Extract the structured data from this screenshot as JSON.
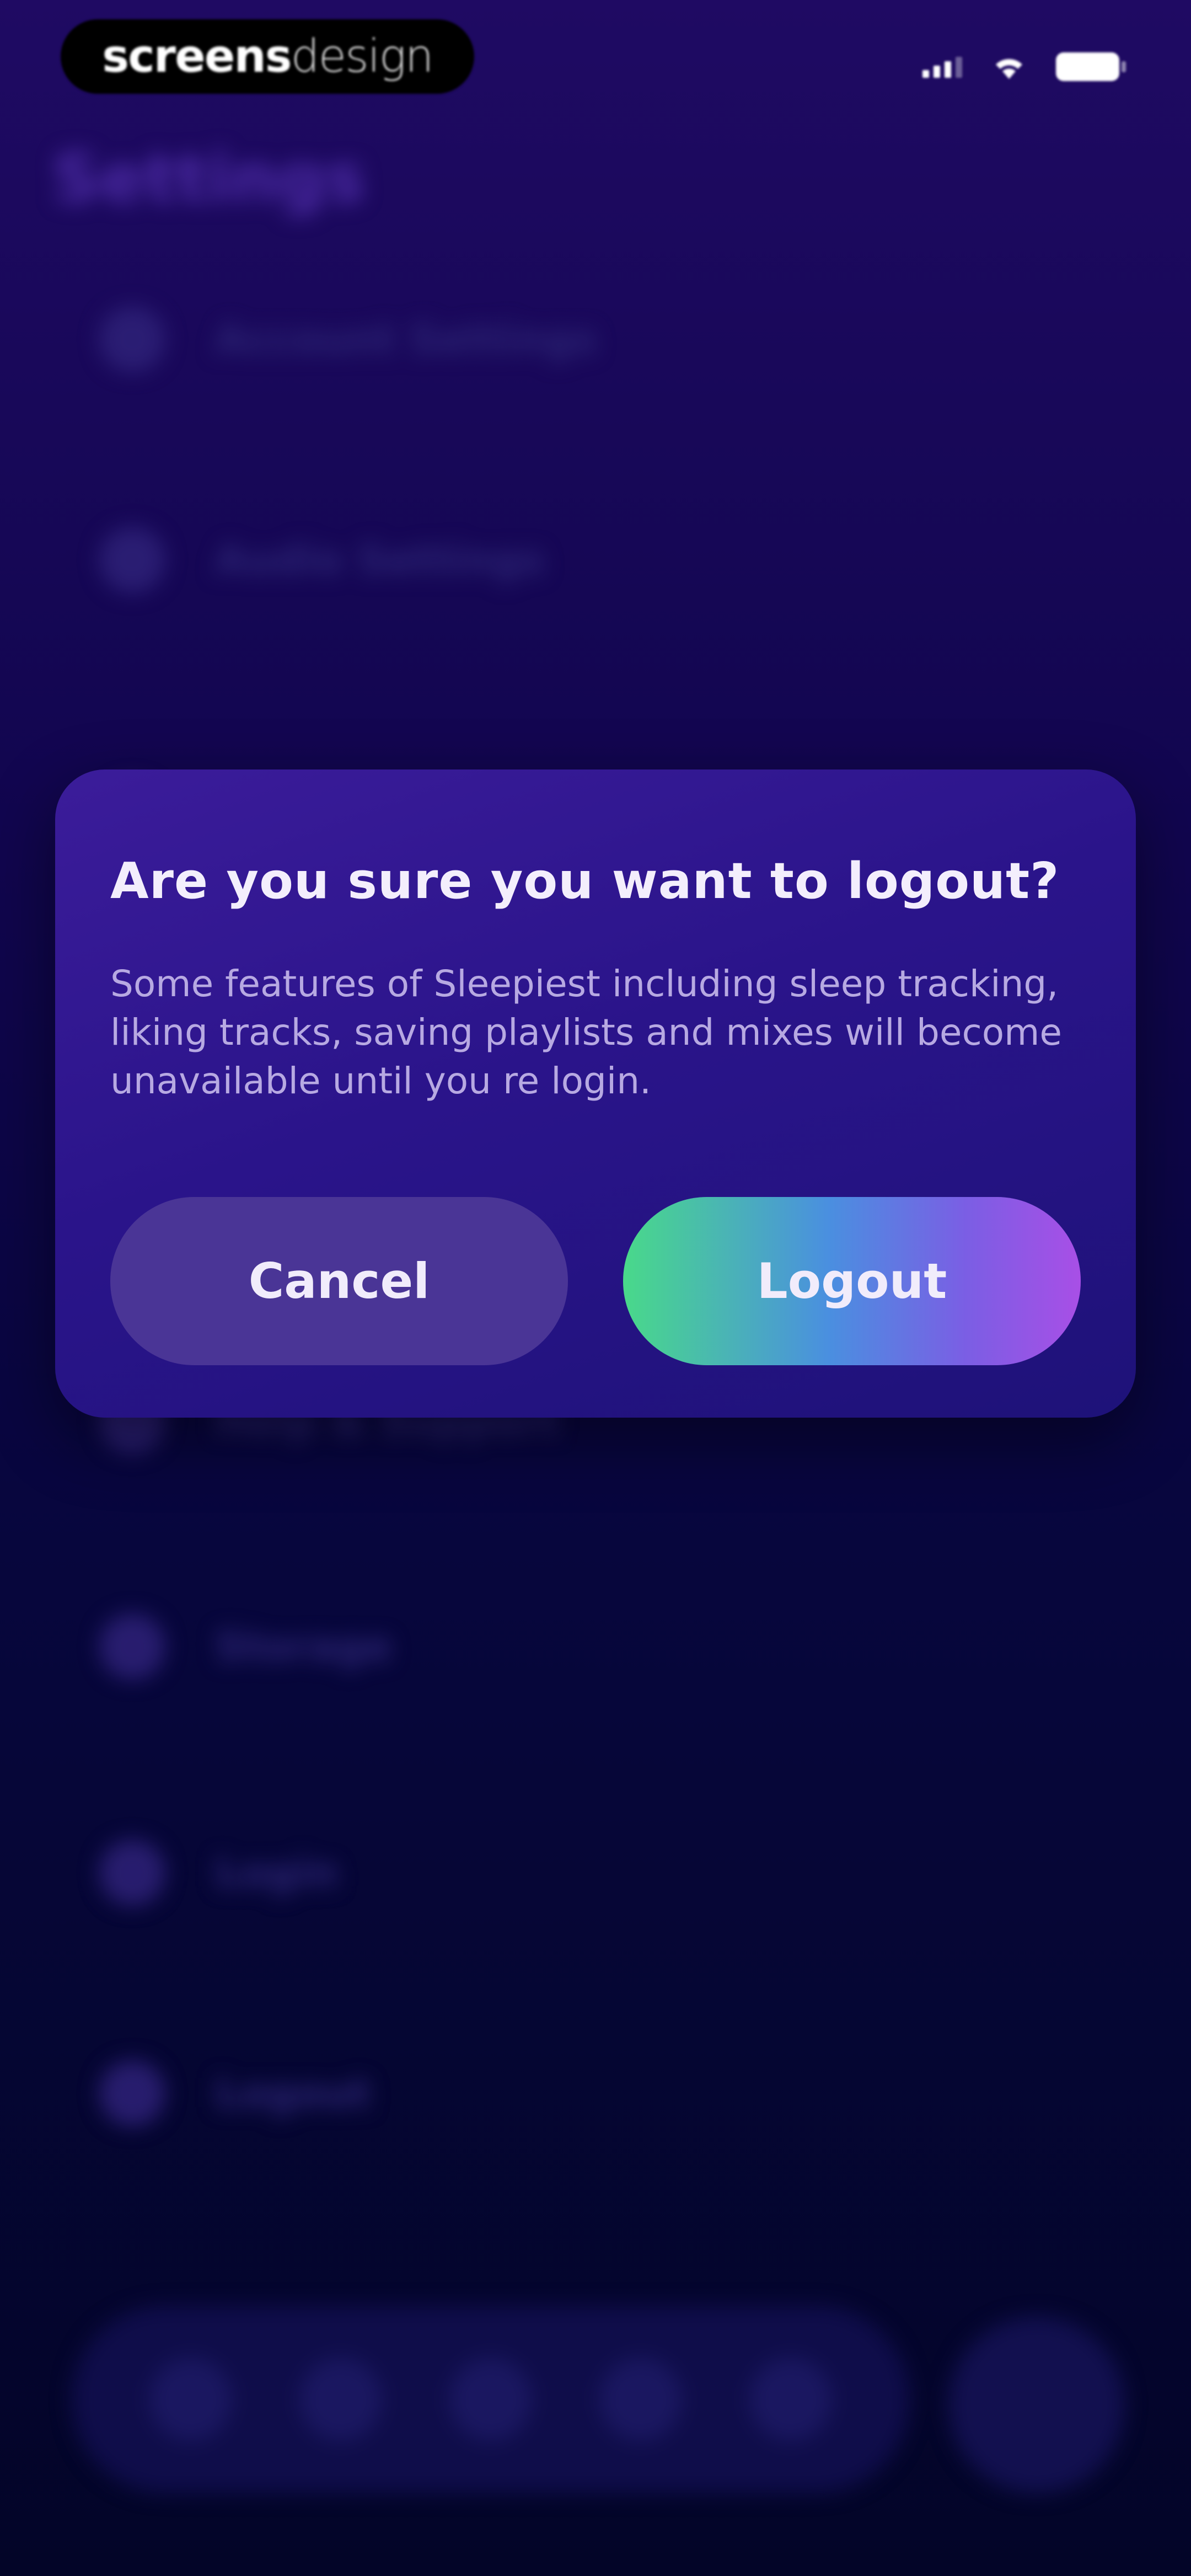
{
  "status_bar": {
    "brand_bold": "screens",
    "brand_light": "design",
    "signal_icon": "cellular-signal-icon",
    "wifi_icon": "wifi-icon",
    "battery_icon": "battery-icon"
  },
  "background": {
    "title": "Settings",
    "items": [
      {
        "label": "Account Settings",
        "icon": "person-icon"
      },
      {
        "label": "Audio Settings",
        "icon": "speaker-icon"
      },
      {
        "label": "",
        "icon": "item-icon"
      },
      {
        "label": "",
        "icon": "item-icon"
      },
      {
        "label": "Help & Support",
        "icon": "help-icon"
      },
      {
        "label": "Storage",
        "icon": "storage-icon"
      },
      {
        "label": "Login",
        "icon": "key-icon"
      },
      {
        "label": "Logout",
        "icon": "logout-icon"
      }
    ]
  },
  "dialog": {
    "title": "Are you sure you want to logout?",
    "message": "Some features of Sleepiest including sleep tracking, liking tracks, saving playlists and mixes will become unavailable until you re login.",
    "cancel_label": "Cancel",
    "logout_label": "Logout"
  },
  "colors": {
    "background_top": "#1f0a63",
    "background_bottom": "#030528",
    "dialog": "#2a148a",
    "cancel_button": "#4a3596",
    "logout_gradient_start": "#49d98a",
    "logout_gradient_end": "#a84fe6"
  }
}
